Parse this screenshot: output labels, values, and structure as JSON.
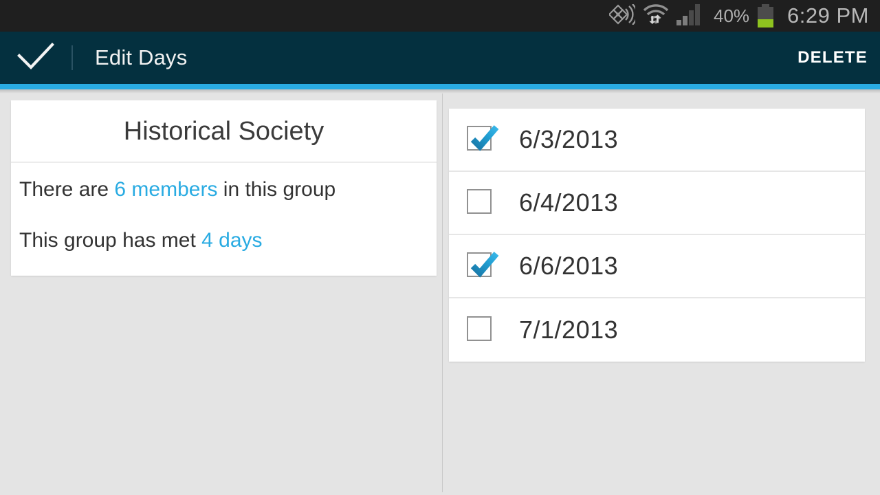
{
  "status_bar": {
    "cast_icon": "screen-cast-icon",
    "wifi_icon": "wifi-transfer-icon",
    "signal_icon": "cellular-signal-icon",
    "battery_percent": "40%",
    "battery_icon": "battery-icon",
    "clock": "6:29 PM",
    "background": "#1f1f1f"
  },
  "action_bar": {
    "done_icon": "checkmark-icon",
    "title": "Edit Days",
    "delete_label": "DELETE",
    "background": "#04303f",
    "accent": "#29abe2"
  },
  "group_card": {
    "title": "Historical Society",
    "stats": [
      {
        "prefix": "There are ",
        "highlight": "6 members",
        "suffix": " in this group"
      },
      {
        "prefix": "This group has met ",
        "highlight": "4 days",
        "suffix": ""
      }
    ],
    "highlight_color": "#29abe2"
  },
  "date_list": [
    {
      "label": "6/3/2013",
      "checked": true
    },
    {
      "label": "6/4/2013",
      "checked": false
    },
    {
      "label": "6/6/2013",
      "checked": true
    },
    {
      "label": "7/1/2013",
      "checked": false
    }
  ]
}
